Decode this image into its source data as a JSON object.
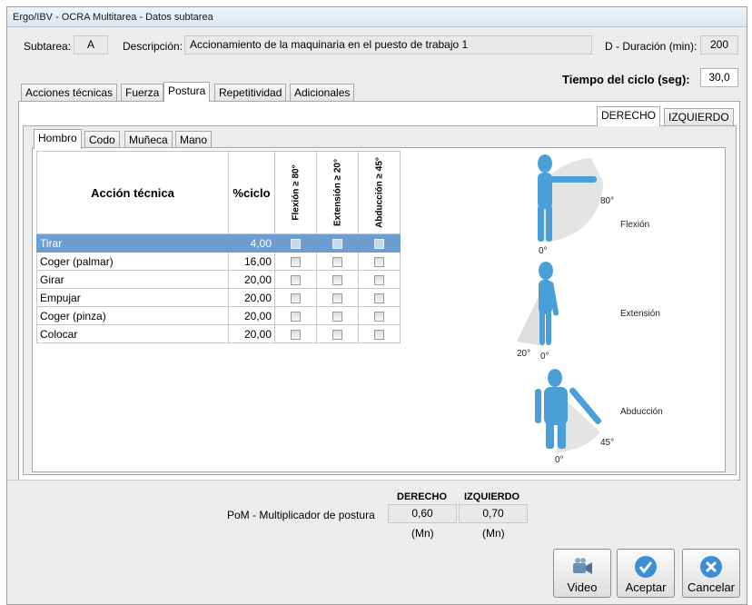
{
  "window": {
    "title": "Ergo/IBV - OCRA Multitarea - Datos subtarea"
  },
  "header": {
    "subtarea_label": "Subtarea:",
    "subtarea_value": "A",
    "descripcion_label": "Descripción:",
    "descripcion_value": "Accionamiento de la maquinaria en el puesto de trabajo 1",
    "duracion_label": "D - Duración (min):",
    "duracion_value": "200",
    "ciclo_label": "Tiempo del ciclo (seg):",
    "ciclo_value": "30,0"
  },
  "main_tabs": [
    "Acciones técnicas",
    "Fuerza",
    "Postura",
    "Repetitividad",
    "Adicionales"
  ],
  "side_tabs": [
    "DERECHO",
    "IZQUIERDO"
  ],
  "joint_tabs": [
    "Hombro",
    "Codo",
    "Muñeca",
    "Mano"
  ],
  "table": {
    "headers": [
      "Acción técnica",
      "%ciclo",
      "Flexión ≥ 80°",
      "Extensión ≥ 20°",
      "Abducción ≥ 45°"
    ],
    "rows": [
      {
        "accion": "Tirar",
        "ciclo": "4,00",
        "selected": true
      },
      {
        "accion": "Coger (palmar)",
        "ciclo": "16,00",
        "selected": false
      },
      {
        "accion": "Girar",
        "ciclo": "20,00",
        "selected": false
      },
      {
        "accion": "Empujar",
        "ciclo": "20,00",
        "selected": false
      },
      {
        "accion": "Coger (pinza)",
        "ciclo": "20,00",
        "selected": false
      },
      {
        "accion": "Colocar",
        "ciclo": "20,00",
        "selected": false
      }
    ]
  },
  "figure": {
    "flexion_label": "Flexión",
    "flexion_angle": "80°",
    "flexion_zero": "0°",
    "extension_label": "Extensión",
    "extension_angle": "20°",
    "extension_zero": "0°",
    "abduccion_label": "Abducción",
    "abduccion_angle": "45°",
    "abduccion_zero": "0°"
  },
  "summary": {
    "derecho_header": "DERECHO",
    "izquierdo_header": "IZQUIERDO",
    "pom_label": "PoM - Multiplicador de postura",
    "derecho_value": "0,60",
    "izquierdo_value": "0,70",
    "derecho_unit": "(Mn)",
    "izquierdo_unit": "(Mn)"
  },
  "buttons": {
    "video": "Video",
    "aceptar": "Aceptar",
    "cancelar": "Cancelar"
  },
  "colors": {
    "selected_row": "#6d9dd1",
    "figure_blue": "#4a9fd8",
    "button_blue": "#3a8fd6"
  }
}
